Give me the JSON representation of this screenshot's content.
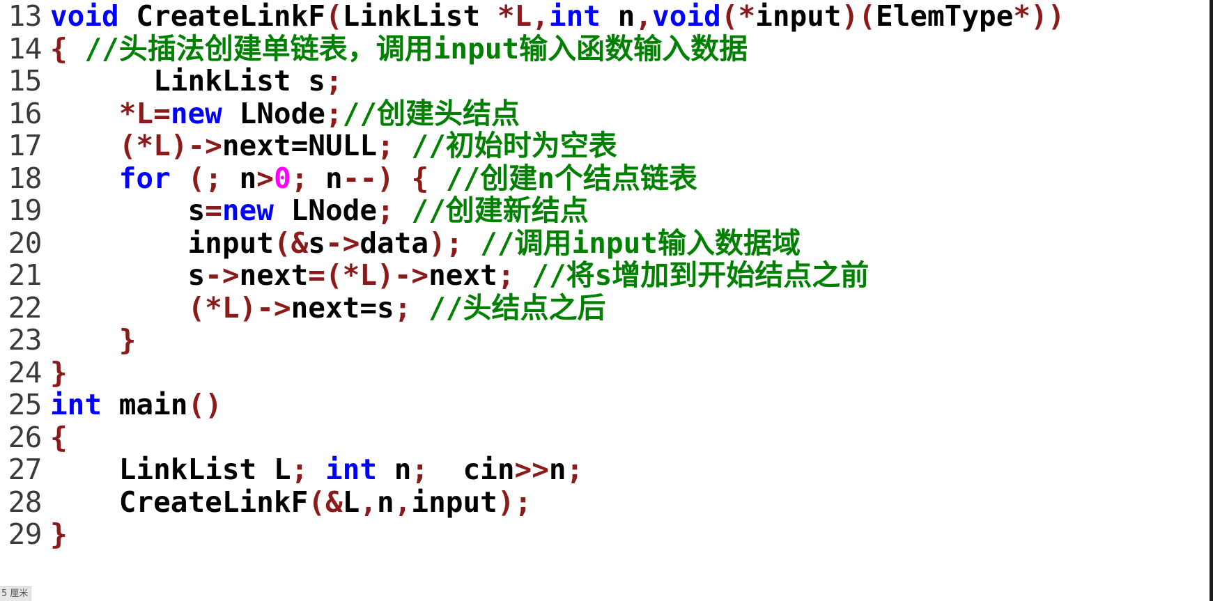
{
  "editor": {
    "background_color": "#ffffff",
    "colors": {
      "plain": "#000000",
      "keyword": "#0000ff",
      "comment": "#008000",
      "punctuation": "#8b1a1a",
      "number": "#ff00ff",
      "line_number": "#3a3a3a"
    },
    "first_line_number": 13,
    "last_line_number": 29,
    "lines": [
      {
        "number": "13",
        "indent": "",
        "tokens": [
          {
            "text": "void",
            "type": "keyword"
          },
          {
            "text": " CreateLinkF",
            "type": "plain"
          },
          {
            "text": "(",
            "type": "punct"
          },
          {
            "text": "LinkList ",
            "type": "plain"
          },
          {
            "text": "*L,",
            "type": "punct"
          },
          {
            "text": "int",
            "type": "keyword"
          },
          {
            "text": " n",
            "type": "plain"
          },
          {
            "text": ",",
            "type": "punct"
          },
          {
            "text": "void",
            "type": "keyword"
          },
          {
            "text": "(*",
            "type": "punct"
          },
          {
            "text": "input",
            "type": "plain"
          },
          {
            "text": ")(",
            "type": "punct"
          },
          {
            "text": "ElemType",
            "type": "plain"
          },
          {
            "text": "*))",
            "type": "punct"
          }
        ]
      },
      {
        "number": "14",
        "indent": "",
        "tokens": [
          {
            "text": "{",
            "type": "punct"
          },
          {
            "text": " ",
            "type": "plain"
          },
          {
            "text": "//头插法创建单链表，调用input输入函数输入数据",
            "type": "comment"
          }
        ]
      },
      {
        "number": "15",
        "indent": "      ",
        "tokens": [
          {
            "text": "LinkList s",
            "type": "plain"
          },
          {
            "text": ";",
            "type": "punct"
          }
        ]
      },
      {
        "number": "16",
        "indent": "    ",
        "tokens": [
          {
            "text": "*L=",
            "type": "punct"
          },
          {
            "text": "new",
            "type": "keyword"
          },
          {
            "text": " LNode",
            "type": "plain"
          },
          {
            "text": ";",
            "type": "punct"
          },
          {
            "text": "//创建头结点",
            "type": "comment"
          }
        ]
      },
      {
        "number": "17",
        "indent": "    ",
        "tokens": [
          {
            "text": "(*L)->",
            "type": "punct"
          },
          {
            "text": "next=NULL",
            "type": "plain"
          },
          {
            "text": ";",
            "type": "punct"
          },
          {
            "text": " ",
            "type": "plain"
          },
          {
            "text": "//初始时为空表",
            "type": "comment"
          }
        ]
      },
      {
        "number": "18",
        "indent": "    ",
        "tokens": [
          {
            "text": "for",
            "type": "keyword"
          },
          {
            "text": " ",
            "type": "plain"
          },
          {
            "text": "(;",
            "type": "punct"
          },
          {
            "text": " n",
            "type": "plain"
          },
          {
            "text": ">",
            "type": "punct"
          },
          {
            "text": "0",
            "type": "number"
          },
          {
            "text": ";",
            "type": "punct"
          },
          {
            "text": " n",
            "type": "plain"
          },
          {
            "text": "--)",
            "type": "punct"
          },
          {
            "text": " ",
            "type": "plain"
          },
          {
            "text": "{",
            "type": "punct"
          },
          {
            "text": " ",
            "type": "plain"
          },
          {
            "text": "//创建n个结点链表",
            "type": "comment"
          }
        ]
      },
      {
        "number": "19",
        "indent": "        ",
        "tokens": [
          {
            "text": "s",
            "type": "plain"
          },
          {
            "text": "=",
            "type": "punct"
          },
          {
            "text": "new",
            "type": "keyword"
          },
          {
            "text": " LNode",
            "type": "plain"
          },
          {
            "text": ";",
            "type": "punct"
          },
          {
            "text": " ",
            "type": "plain"
          },
          {
            "text": "//创建新结点",
            "type": "comment"
          }
        ]
      },
      {
        "number": "20",
        "indent": "        ",
        "tokens": [
          {
            "text": "input",
            "type": "plain"
          },
          {
            "text": "(&",
            "type": "punct"
          },
          {
            "text": "s",
            "type": "plain"
          },
          {
            "text": "->",
            "type": "punct"
          },
          {
            "text": "data",
            "type": "plain"
          },
          {
            "text": ");",
            "type": "punct"
          },
          {
            "text": " ",
            "type": "plain"
          },
          {
            "text": "//调用input输入数据域",
            "type": "comment"
          }
        ]
      },
      {
        "number": "21",
        "indent": "        ",
        "tokens": [
          {
            "text": "s",
            "type": "plain"
          },
          {
            "text": "->",
            "type": "punct"
          },
          {
            "text": "next",
            "type": "plain"
          },
          {
            "text": "=(*L)->",
            "type": "punct"
          },
          {
            "text": "next",
            "type": "plain"
          },
          {
            "text": ";",
            "type": "punct"
          },
          {
            "text": " ",
            "type": "plain"
          },
          {
            "text": "//将s增加到开始结点之前",
            "type": "comment"
          }
        ]
      },
      {
        "number": "22",
        "indent": "        ",
        "tokens": [
          {
            "text": "(*L)->",
            "type": "punct"
          },
          {
            "text": "next=s",
            "type": "plain"
          },
          {
            "text": ";",
            "type": "punct"
          },
          {
            "text": " ",
            "type": "plain"
          },
          {
            "text": "//头结点之后",
            "type": "comment"
          }
        ]
      },
      {
        "number": "23",
        "indent": "    ",
        "tokens": [
          {
            "text": "}",
            "type": "punct"
          }
        ]
      },
      {
        "number": "24",
        "indent": "",
        "tokens": [
          {
            "text": "}",
            "type": "punct"
          }
        ]
      },
      {
        "number": "25",
        "indent": "",
        "tokens": [
          {
            "text": "int",
            "type": "keyword"
          },
          {
            "text": " main",
            "type": "plain"
          },
          {
            "text": "()",
            "type": "punct"
          }
        ]
      },
      {
        "number": "26",
        "indent": "",
        "tokens": [
          {
            "text": "{",
            "type": "punct"
          }
        ]
      },
      {
        "number": "27",
        "indent": "    ",
        "tokens": [
          {
            "text": "LinkList L",
            "type": "plain"
          },
          {
            "text": ";",
            "type": "punct"
          },
          {
            "text": " ",
            "type": "plain"
          },
          {
            "text": "int",
            "type": "keyword"
          },
          {
            "text": " n",
            "type": "plain"
          },
          {
            "text": ";",
            "type": "punct"
          },
          {
            "text": "  cin",
            "type": "plain"
          },
          {
            "text": ">>",
            "type": "punct"
          },
          {
            "text": "n",
            "type": "plain"
          },
          {
            "text": ";",
            "type": "punct"
          }
        ]
      },
      {
        "number": "28",
        "indent": "    ",
        "tokens": [
          {
            "text": "CreateLinkF",
            "type": "plain"
          },
          {
            "text": "(&",
            "type": "punct"
          },
          {
            "text": "L",
            "type": "plain"
          },
          {
            "text": ",",
            "type": "punct"
          },
          {
            "text": "n",
            "type": "plain"
          },
          {
            "text": ",",
            "type": "punct"
          },
          {
            "text": "input",
            "type": "plain"
          },
          {
            "text": ");",
            "type": "punct"
          }
        ]
      },
      {
        "number": "29",
        "indent": "",
        "tokens": [
          {
            "text": "}",
            "type": "punct"
          }
        ]
      }
    ]
  },
  "overlay": {
    "ruler_tooltip": "5 厘米"
  }
}
